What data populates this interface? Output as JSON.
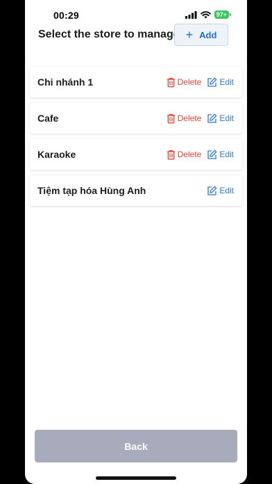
{
  "status_bar": {
    "time": "00:29",
    "battery": "97+",
    "icons": [
      "cellular-signal-icon",
      "wifi-icon",
      "battery-icon"
    ]
  },
  "header": {
    "title": "Select the store to manage",
    "add_label": "Add"
  },
  "stores": [
    {
      "name": "Chi nhánh 1",
      "delete_label": "Delete",
      "edit_label": "Edit"
    },
    {
      "name": "Cafe",
      "delete_label": "Delete",
      "edit_label": "Edit"
    },
    {
      "name": "Karaoke",
      "delete_label": "Delete",
      "edit_label": "Edit"
    },
    {
      "name": "Tiệm tạp hóa Hùng Anh",
      "edit_label": "Edit"
    }
  ],
  "footer": {
    "back_label": "Back"
  },
  "colors": {
    "accent_blue": "#1f6fd1",
    "delete_red": "#e0443d",
    "back_button": "#a7abbb",
    "battery_green": "#34c759"
  }
}
